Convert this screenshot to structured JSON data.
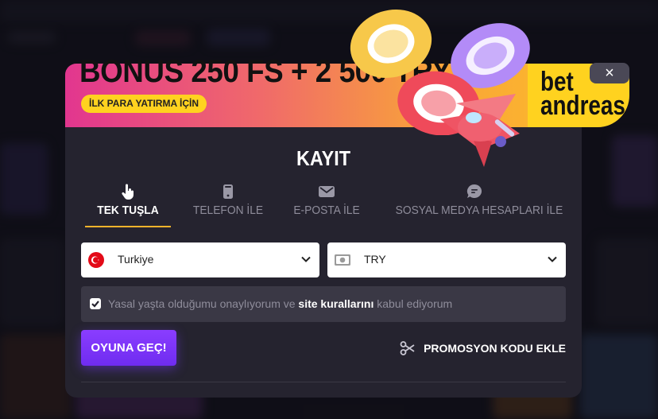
{
  "banner": {
    "title": "BONUS 250 FS + 2 500 TRY",
    "subtitle": "İLK PARA YATIRMA İÇİN",
    "logo_line1": "bet",
    "logo_line2": "andreas",
    "close_label": "×"
  },
  "form": {
    "title": "KAYIT",
    "tabs": [
      {
        "label": "TEK TUŞLA",
        "icon": "pointer-hand-icon",
        "active": true
      },
      {
        "label": "TELEFON İLE",
        "icon": "phone-icon",
        "active": false
      },
      {
        "label": "E-POSTA İLE",
        "icon": "envelope-icon",
        "active": false
      },
      {
        "label": "SOSYAL MEDYA HESAPLARI İLE",
        "icon": "chat-bubble-icon",
        "active": false
      }
    ],
    "country": {
      "value": "Turkiye",
      "icon": "turkey-flag-icon"
    },
    "currency": {
      "value": "TRY",
      "icon": "banknote-icon"
    },
    "terms": {
      "prefix": "Yasal yaşta olduğumu onaylıyorum ve ",
      "link": "site kurallarını",
      "suffix": " kabul ediyorum",
      "checked": true
    },
    "submit_label": "OYUNA GEÇ!",
    "promo_label": "PROMOSYON KODU EKLE"
  },
  "colors": {
    "accent_purple": "#7a33f5",
    "tab_underline": "#f3b32b",
    "logo_yellow": "#ffd21f",
    "modal_bg": "#25232f"
  }
}
